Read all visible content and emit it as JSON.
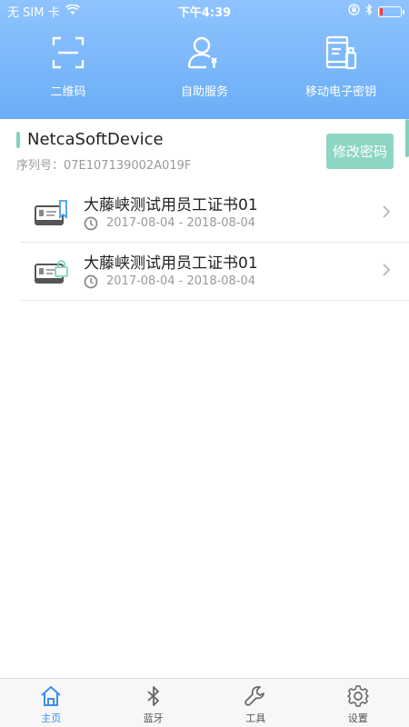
{
  "status_bar": {
    "carrier": "无 SIM 卡",
    "time": "下午4:39",
    "battery_level": 0.12,
    "battery_color": "#ff3b30"
  },
  "quick_actions": [
    {
      "label": "二维码",
      "icon": "qr-scan-icon"
    },
    {
      "label": "自助服务",
      "icon": "self-service-icon"
    },
    {
      "label": "移动电子密钥",
      "icon": "mobile-key-icon"
    }
  ],
  "device": {
    "name": "NetcaSoftDevice",
    "serial": "序列号：07E107139002A019F",
    "change_password_label": "修改密码"
  },
  "certificates": [
    {
      "title": "大藤峡测试用员工证书01",
      "validity": "2017-08-04 - 2018-08-04",
      "icon": "certificate-signing-icon"
    },
    {
      "title": "大藤峡测试用员工证书01",
      "validity": "2017-08-04 - 2018-08-04",
      "icon": "certificate-encryption-icon"
    }
  ],
  "tabbar": [
    {
      "label": "主页",
      "icon": "home-icon",
      "active": true
    },
    {
      "label": "蓝牙",
      "icon": "bluetooth-icon",
      "active": false
    },
    {
      "label": "工具",
      "icon": "wrench-icon",
      "active": false
    },
    {
      "label": "设置",
      "icon": "gear-icon",
      "active": false
    }
  ],
  "colors": {
    "header": "#79b6fa",
    "accent": "#8dd6c4",
    "tab_active": "#3d8ef0"
  }
}
